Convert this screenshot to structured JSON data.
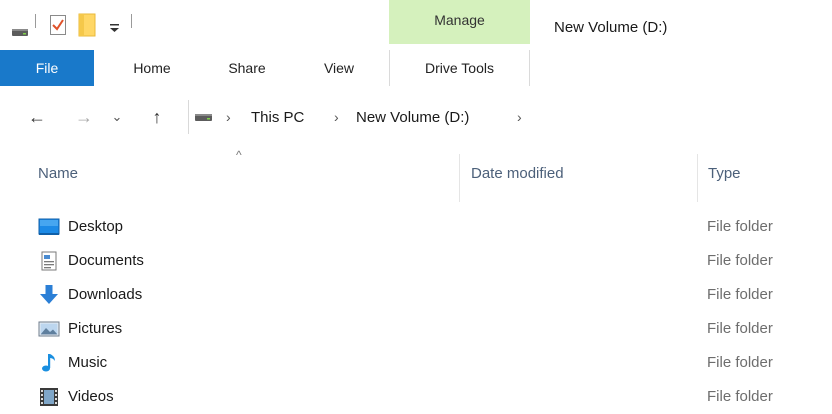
{
  "title_bar": {
    "window_title": "New Volume (D:)",
    "contextual_tab_group": "Manage",
    "quick_access_icons": [
      "drive-icon",
      "properties-icon",
      "new-folder-icon",
      "customize-qat-icon"
    ]
  },
  "ribbon": {
    "tabs": [
      {
        "label": "File",
        "active": true
      },
      {
        "label": "Home"
      },
      {
        "label": "Share"
      },
      {
        "label": "View"
      },
      {
        "label": "Drive Tools"
      }
    ]
  },
  "address_bar": {
    "nav": {
      "back": "←",
      "forward": "→",
      "recent": "⌄",
      "up": "↑"
    },
    "breadcrumbs": [
      "This PC",
      "New Volume (D:)"
    ],
    "separator": "›"
  },
  "columns": {
    "name": "Name",
    "date_modified": "Date modified",
    "type": "Type",
    "sort_indicator": "^"
  },
  "items": [
    {
      "name": "Desktop",
      "type": "File folder",
      "icon": "desktop-icon"
    },
    {
      "name": "Documents",
      "type": "File folder",
      "icon": "documents-icon"
    },
    {
      "name": "Downloads",
      "type": "File folder",
      "icon": "downloads-icon"
    },
    {
      "name": "Pictures",
      "type": "File folder",
      "icon": "pictures-icon"
    },
    {
      "name": "Music",
      "type": "File folder",
      "icon": "music-icon"
    },
    {
      "name": "Videos",
      "type": "File folder",
      "icon": "videos-icon"
    }
  ],
  "colors": {
    "file_tab": "#1979ca",
    "manage_tab": "#d5f1bd",
    "column_header_text": "#4c607a",
    "downloads_arrow": "#2b7fd6",
    "music_note": "#1a8fe0"
  }
}
